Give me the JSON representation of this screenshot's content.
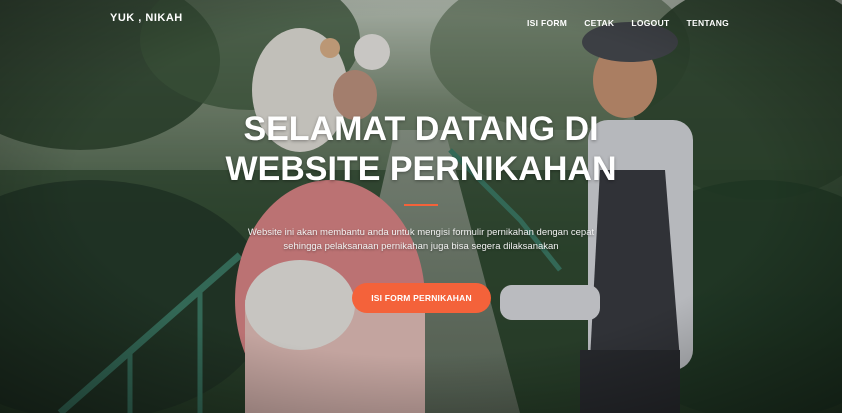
{
  "brand": {
    "name": "YUK , NIKAH"
  },
  "nav": {
    "items": [
      {
        "label": "ISI FORM"
      },
      {
        "label": "CETAK"
      },
      {
        "label": "LOGOUT"
      },
      {
        "label": "TENTANG"
      }
    ]
  },
  "hero": {
    "headline_line1": "SELAMAT DATANG DI",
    "headline_line2": "WEBSITE PERNIKAHAN",
    "intro_line1": "Website ini akan membantu anda untuk mengisi formulir pernikahan dengan cepat",
    "intro_line2": "sehingga pelaksanaan pernikahan juga bisa segera dilaksanakan",
    "cta_label": "ISI FORM PERNIKAHAN"
  },
  "colors": {
    "accent": "#f4623a",
    "text": "#ffffff"
  }
}
